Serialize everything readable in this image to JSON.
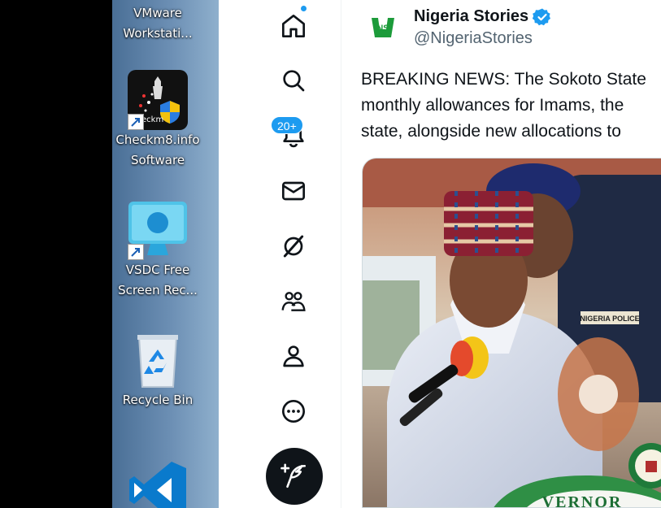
{
  "desktop": {
    "icons": [
      {
        "label_lines": [
          "VMware",
          "Workstati..."
        ],
        "icon": "vmware-icon"
      },
      {
        "label_lines": [
          "Checkm8.info",
          "Software"
        ],
        "icon": "checkm8-icon",
        "icon_text": "eckm"
      },
      {
        "label_lines": [
          "VSDC Free",
          "Screen Rec..."
        ],
        "icon": "vsdc-icon"
      },
      {
        "label_lines": [
          "Recycle Bin"
        ],
        "icon": "recycle-bin-icon"
      },
      {
        "label_lines": [],
        "icon": "vscode-icon"
      }
    ]
  },
  "nav": {
    "items": [
      {
        "name": "home",
        "icon": "home-icon"
      },
      {
        "name": "explore",
        "icon": "search-icon"
      },
      {
        "name": "notifications",
        "icon": "bell-icon",
        "badge": "20+"
      },
      {
        "name": "messages",
        "icon": "mail-icon"
      },
      {
        "name": "grok",
        "icon": "grok-icon"
      },
      {
        "name": "communities",
        "icon": "communities-icon"
      },
      {
        "name": "profile",
        "icon": "person-icon"
      },
      {
        "name": "more",
        "icon": "more-icon"
      }
    ],
    "post_button_icon": "feather-plus-icon"
  },
  "tweet": {
    "author_name": "Nigeria Stories",
    "author_handle": "@NigeriaStories",
    "avatar_text": "NS",
    "text_lines": [
      "BREAKING NEWS: The Sokoto State",
      "monthly allowances for Imams, the",
      "state, alongside new allocations to"
    ],
    "media_text": "NIGERIA POLICE",
    "podium_text": "VERNOR"
  },
  "colors": {
    "accent": "#1d9bf0",
    "text": "#0f1419",
    "secondary": "#536471"
  }
}
